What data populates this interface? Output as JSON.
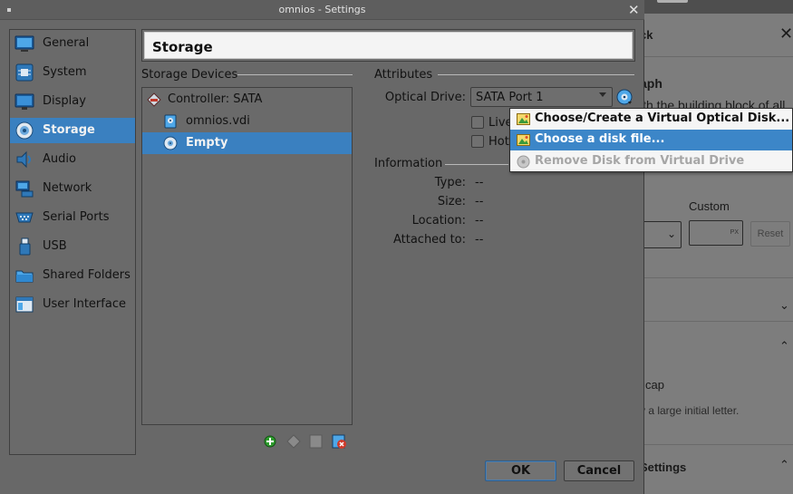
{
  "window": {
    "title": "omnios - Settings"
  },
  "sidebar": {
    "items": [
      {
        "label": "General",
        "icon": "general-icon"
      },
      {
        "label": "System",
        "icon": "system-icon"
      },
      {
        "label": "Display",
        "icon": "display-icon"
      },
      {
        "label": "Storage",
        "icon": "storage-icon",
        "selected": true
      },
      {
        "label": "Audio",
        "icon": "audio-icon"
      },
      {
        "label": "Network",
        "icon": "network-icon"
      },
      {
        "label": "Serial Ports",
        "icon": "serial-ports-icon"
      },
      {
        "label": "USB",
        "icon": "usb-icon"
      },
      {
        "label": "Shared Folders",
        "icon": "shared-folders-icon"
      },
      {
        "label": "User Interface",
        "icon": "user-interface-icon"
      }
    ]
  },
  "page": {
    "title": "Storage"
  },
  "storage_devices": {
    "title": "Storage Devices",
    "controller": "Controller: SATA",
    "items": [
      {
        "label": "omnios.vdi",
        "icon": "hard-disk-icon"
      },
      {
        "label": "Empty",
        "icon": "optical-disc-icon",
        "selected": true
      }
    ]
  },
  "attributes": {
    "title": "Attributes",
    "optical_drive_label": "Optical Drive:",
    "optical_drive_value": "SATA Port 1",
    "live_cd_label": "Live",
    "hot_pluggable_label": "Hot"
  },
  "information": {
    "title": "Information",
    "type_label": "Type:",
    "type_value": "--",
    "size_label": "Size:",
    "size_value": "--",
    "location_label": "Location:",
    "location_value": "--",
    "attached_label": "Attached to:",
    "attached_value": "--"
  },
  "popup_menu": {
    "items": [
      {
        "label": "Choose/Create a Virtual Optical Disk..."
      },
      {
        "label": "Choose a disk file...",
        "highlighted": true
      },
      {
        "label": "Remove Disk from Virtual Drive",
        "disabled": true
      }
    ]
  },
  "buttons": {
    "ok": "OK",
    "cancel": "Cancel"
  },
  "background_editor": {
    "tab_label": "ck",
    "block_title": "aph",
    "block_desc": "ith the building block of all",
    "custom_label": "Custom",
    "px_unit": "PX",
    "reset_label": "Reset",
    "drop_cap_label": "cap",
    "drop_cap_desc": "v a large initial letter.",
    "settings_label": "Settings"
  },
  "colors": {
    "selection": "#3a80c0",
    "menu_highlight": "#3c86c8",
    "dialog_bg": "#686868"
  }
}
